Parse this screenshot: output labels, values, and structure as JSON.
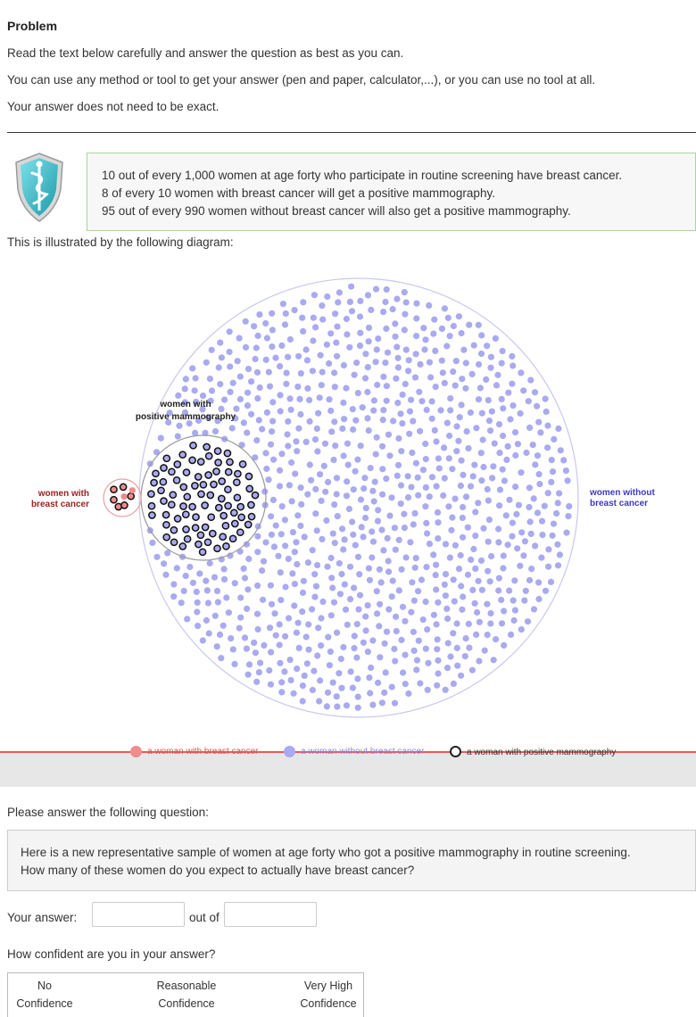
{
  "problem": {
    "heading": "Problem",
    "instructions": [
      "Read the text below carefully and answer the question as best as you can.",
      "You can use any method or tool to get your answer (pen and paper, calculator,...), or you can use no tool at all.",
      "Your answer does not need to be exact."
    ]
  },
  "facts": [
    "10 out of every 1,000 women at age forty who participate in routine screening have breast cancer.",
    "8 of every 10 women with breast cancer will get a positive mammography.",
    "95 out of every 990 women without breast cancer will also get a positive mammography."
  ],
  "diagram": {
    "caption": "This is illustrated by the following diagram:",
    "label_positive_line1": "women with",
    "label_positive_line2": "positive mammography",
    "label_cancer_line1": "women with",
    "label_cancer_line2": "breast cancer",
    "label_no_cancer_line1": "women without",
    "label_no_cancer_line2": "breast cancer",
    "counts": {
      "total": 1000,
      "cancer": 10,
      "cancer_positive": 8,
      "no_cancer": 990,
      "no_cancer_positive": 95
    },
    "colors": {
      "cancer": "#f28b8b",
      "no_cancer": "#aaaaf0",
      "circle": "#c8c8ee",
      "red_label": "#a02020",
      "blue_label": "#3a3ac8"
    }
  },
  "legend": {
    "cancer": "a woman with breast cancer",
    "no_cancer": "a woman without breast cancer",
    "positive": "a woman with positive mammography"
  },
  "question": {
    "prompt": "Please answer the following question:",
    "line1": "Here is a new representative sample of women at age forty who got a positive mammography in routine screening.",
    "line2": "How many of these women do you expect to actually have breast cancer?"
  },
  "answer": {
    "label": "Your answer:",
    "numerator_value": "",
    "out_of_label": "out of",
    "denominator_value": ""
  },
  "confidence": {
    "question": "How confident are you in your answer?",
    "options": [
      {
        "line1": "No",
        "line2": "Confidence"
      },
      {
        "line1": "Reasonable",
        "line2": "Confidence"
      },
      {
        "line1": "Very High",
        "line2": "Confidence"
      }
    ]
  }
}
